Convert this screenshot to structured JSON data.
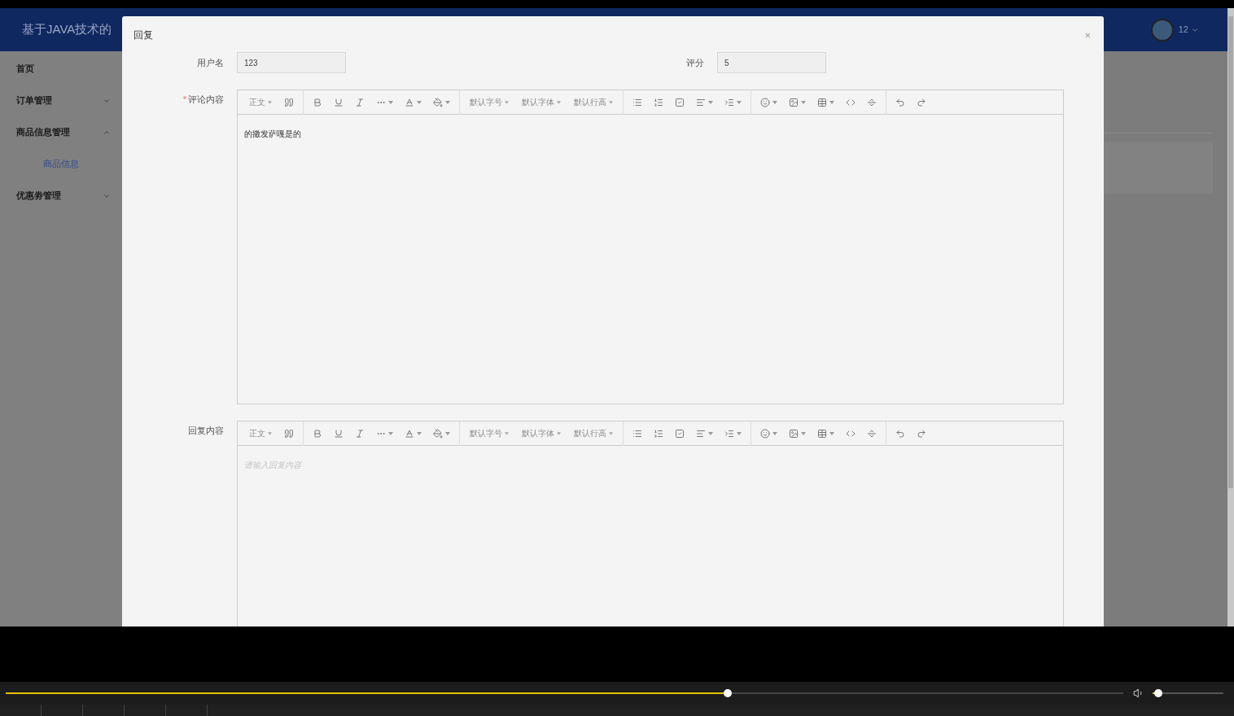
{
  "header": {
    "title": "基于JAVA技术的",
    "user": "12"
  },
  "sidebar": {
    "items": [
      {
        "label": "首页"
      },
      {
        "label": "订单管理",
        "expanded": false
      },
      {
        "label": "商品信息管理",
        "expanded": true,
        "children": [
          {
            "label": "商品信息",
            "selected": true
          }
        ]
      },
      {
        "label": "优惠劵管理",
        "expanded": false
      }
    ]
  },
  "dialog": {
    "title": "回复",
    "close": "×",
    "fields": [
      {
        "label": "用户名",
        "value": "123"
      },
      {
        "label": "评分",
        "value": "5"
      }
    ],
    "editors": [
      {
        "label": "评论内容",
        "required_mark": "*",
        "toolbar_labels": [
          "正文",
          "默认字号",
          "默认字体",
          "默认行高"
        ],
        "content": "的撒发萨嘎是的"
      },
      {
        "label": "回复内容",
        "toolbar_labels": [
          "正文",
          "默认字号",
          "默认字体",
          "默认行高"
        ],
        "placeholder": "请输入回复内容"
      }
    ]
  },
  "player": {
    "progress": {
      "level": 0.646
    },
    "volume": {
      "level": 0.08
    }
  }
}
